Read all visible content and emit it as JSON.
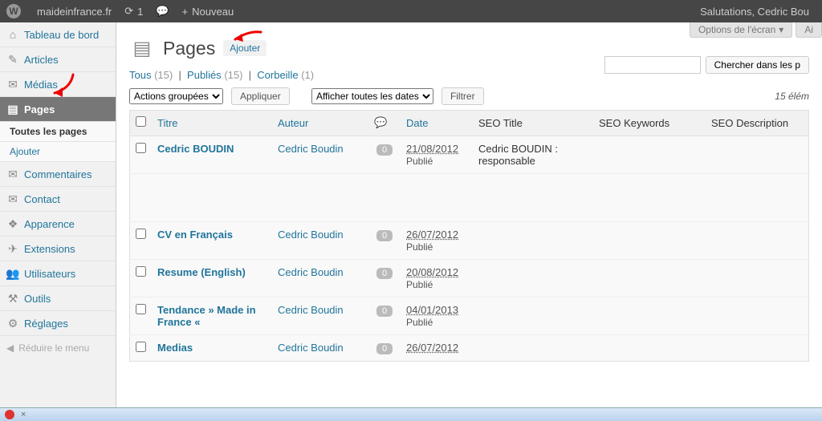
{
  "adminbar": {
    "site": "maideinfrance.fr",
    "updates": "1",
    "new": "Nouveau",
    "greeting": "Salutations, Cedric Bou"
  },
  "screen_meta": {
    "options": "Options de l'écran",
    "help": "Ai"
  },
  "sidebar": {
    "items": [
      {
        "label": "Tableau de bord",
        "icon": "⌂"
      },
      {
        "label": "Articles",
        "icon": "✎"
      },
      {
        "label": "Médias",
        "icon": "✉"
      },
      {
        "label": "Pages",
        "icon": "▤"
      },
      {
        "label": "Commentaires",
        "icon": "✉"
      },
      {
        "label": "Contact",
        "icon": "✉"
      },
      {
        "label": "Apparence",
        "icon": "❖"
      },
      {
        "label": "Extensions",
        "icon": "✈"
      },
      {
        "label": "Utilisateurs",
        "icon": "👥"
      },
      {
        "label": "Outils",
        "icon": "⚒"
      },
      {
        "label": "Réglages",
        "icon": "⚙"
      }
    ],
    "submenu": {
      "all": "Toutes les pages",
      "add": "Ajouter"
    },
    "collapse": "Réduire le menu"
  },
  "heading": {
    "title": "Pages",
    "add": "Ajouter"
  },
  "views": {
    "all": "Tous",
    "all_count": "(15)",
    "published": "Publiés",
    "published_count": "(15)",
    "trash": "Corbeille",
    "trash_count": "(1)"
  },
  "bulk": {
    "label": "Actions groupées",
    "apply": "Appliquer"
  },
  "filter": {
    "dates": "Afficher toutes les dates",
    "button": "Filtrer"
  },
  "count": "15 élém",
  "search": {
    "button": "Chercher dans les p"
  },
  "columns": {
    "title": "Titre",
    "author": "Auteur",
    "date": "Date",
    "seo_title": "SEO Title",
    "seo_keywords": "SEO Keywords",
    "seo_desc": "SEO Description"
  },
  "rows": [
    {
      "title": "Cedric BOUDIN",
      "author": "Cedric Boudin",
      "comments": "0",
      "date": "21/08/2012",
      "status": "Publié",
      "seo_title": "Cedric BOUDIN : responsable"
    },
    {
      "title": "CV en Français",
      "author": "Cedric Boudin",
      "comments": "0",
      "date": "26/07/2012",
      "status": "Publié",
      "seo_title": ""
    },
    {
      "title": "Resume (English)",
      "author": "Cedric Boudin",
      "comments": "0",
      "date": "20/08/2012",
      "status": "Publié",
      "seo_title": ""
    },
    {
      "title": "Tendance  » Made in France «",
      "author": "Cedric Boudin",
      "comments": "0",
      "date": "04/01/2013",
      "status": "Publié",
      "seo_title": ""
    },
    {
      "title": "Medias",
      "author": "Cedric Boudin",
      "comments": "0",
      "date": "26/07/2012",
      "status": "",
      "seo_title": ""
    }
  ],
  "taskbar": {
    "close": "×"
  }
}
